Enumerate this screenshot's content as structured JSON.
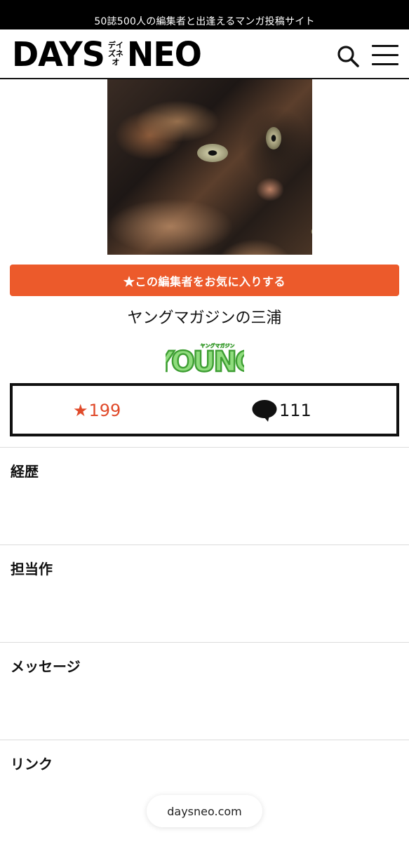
{
  "top_banner": {
    "text": "50誌500人の編集者と出逢えるマンガ投稿サイト"
  },
  "header": {
    "logo_left": "DAYS",
    "logo_kana": "デイズネオ",
    "logo_right": "NEO",
    "search_icon": "search-icon",
    "menu_icon": "hamburger-menu-icon"
  },
  "profile": {
    "photo_icon": "cat-photo",
    "favorite_button_label": "★この編集者をお気に入りする",
    "editor_name": "ヤングマガジンの三浦",
    "magazine_logo_text": "YOUNG",
    "magazine_logo_subtext": "ヤングマガジン"
  },
  "stats": {
    "favorites_icon": "★",
    "favorites_count": "199",
    "comments_icon": "speech-bubble-icon",
    "comments_count": "111"
  },
  "sections": [
    {
      "title": "経歴"
    },
    {
      "title": "担当作"
    },
    {
      "title": "メッセージ"
    },
    {
      "title": "リンク"
    }
  ],
  "browser": {
    "url": "daysneo.com"
  },
  "colors": {
    "accent": "#ec5a2b",
    "favorite_count": "#e04a2a",
    "banner_bg": "#000000",
    "magazine_green": "#5cc34a"
  }
}
